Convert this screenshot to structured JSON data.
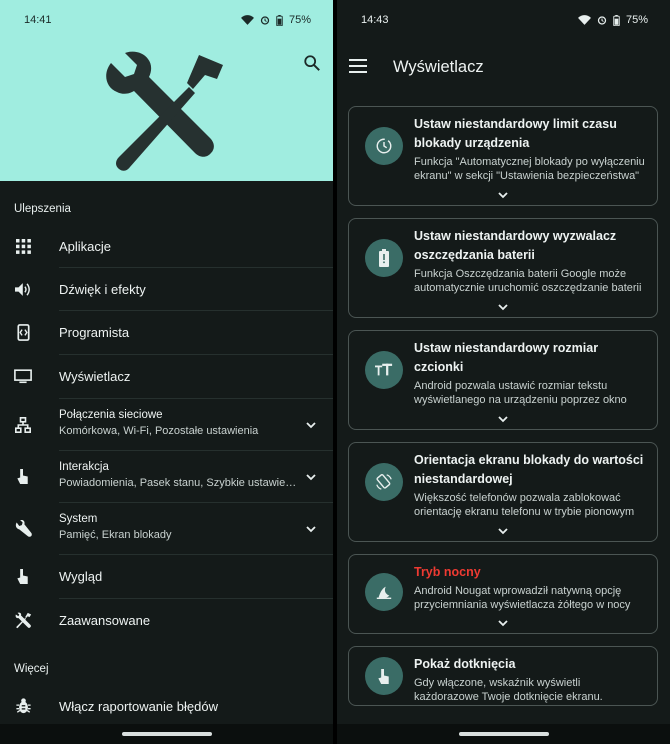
{
  "left": {
    "status": {
      "time": "14:41",
      "battery": "75%"
    },
    "sections": {
      "improvements": "Ulepszenia",
      "more": "Więcej"
    },
    "items": [
      {
        "title": "Aplikacje"
      },
      {
        "title": "Dźwięk i efekty"
      },
      {
        "title": "Programista"
      },
      {
        "title": "Wyświetlacz"
      },
      {
        "title": "Połączenia sieciowe",
        "subtitle": "Komórkowa, Wi-Fi, Pozostałe ustawienia"
      },
      {
        "title": "Interakcja",
        "subtitle": "Powiadomienia, Pasek stanu, Szybkie ustawienia"
      },
      {
        "title": "System",
        "subtitle": "Pamięć, Ekran blokady"
      },
      {
        "title": "Wygląd"
      },
      {
        "title": "Zaawansowane"
      },
      {
        "title": "Włącz raportowanie błędów"
      }
    ]
  },
  "right": {
    "status": {
      "time": "14:43",
      "battery": "75%"
    },
    "appbar_title": "Wyświetlacz",
    "cards": [
      {
        "title": "Ustaw niestandardowy limit czasu blokady urządzenia",
        "description": "Funkcja \"Automatycznej blokady po wyłączeniu ekranu\" w sekcji \"Ustawienia bezpieczeństwa\""
      },
      {
        "title": "Ustaw niestandardowy wyzwalacz oszczędzania baterii",
        "description": "Funkcja Oszczędzania baterii Google może automatycznie uruchomić oszczędzanie baterii"
      },
      {
        "title": "Ustaw niestandardowy rozmiar czcionki",
        "description": "Android pozwala ustawić rozmiar tekstu wyświetlanego na urządzeniu poprzez okno"
      },
      {
        "title": "Orientacja ekranu blokady do wartości niestandardowej",
        "description": "Większość telefonów pozwala zablokować orientację ekranu telefonu w trybie pionowym"
      },
      {
        "title": "Tryb nocny",
        "description": "Android Nougat wprowadził natywną opcję przyciemniania wyświetlacza żółtego w nocy"
      },
      {
        "title": "Pokaż dotknięcia",
        "description": "Gdy włączone, wskaźnik wyświetli każdorazowe Twoje dotknięcie ekranu."
      }
    ]
  },
  "colors": {
    "hero_bg": "#a0ede0",
    "background": "#141a19",
    "icon_circle": "#3a6c66",
    "night_mode_red": "#ee3a32"
  }
}
